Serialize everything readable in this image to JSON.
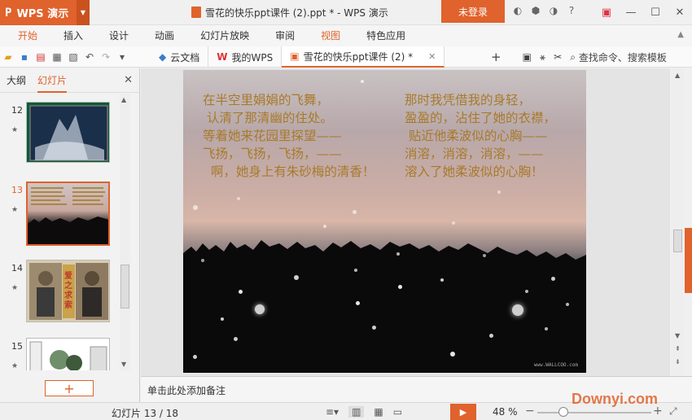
{
  "titlebar": {
    "app_name": "WPS 演示",
    "doc_title": "雪花的快乐ppt课件 (2).ppt * - WPS 演示",
    "login_label": "未登录"
  },
  "menu": {
    "items": [
      "开始",
      "插入",
      "设计",
      "动画",
      "幻灯片放映",
      "审阅",
      "视图",
      "特色应用"
    ]
  },
  "doc_tabs": [
    {
      "label": "云文档"
    },
    {
      "label": "我的WPS"
    },
    {
      "label": "雪花的快乐ppt课件 (2) *"
    }
  ],
  "toolbar": {
    "search_label": "查找命令、搜索模板"
  },
  "left_panel": {
    "tab_outline": "大纲",
    "tab_slides": "幻灯片",
    "thumbnails": [
      {
        "num": "12"
      },
      {
        "num": "13"
      },
      {
        "num": "14"
      },
      {
        "num": "15"
      }
    ],
    "thumb14_text": "爱之求索"
  },
  "slide": {
    "left_poem": "在半空里娟娟的飞舞，\n 认清了那清幽的住处。\n等着她来花园里探望——\n飞扬，飞扬，飞扬，——\n  啊，她身上有朱砂梅的清香！",
    "right_poem": "那时我凭借我的身轻，\n盈盈的，沾住了她的衣襟，\n 贴近他柔波似的心胸——\n消溶，消溶，消溶，——\n溶入了她柔波似的心胸！",
    "watermark": "www.WALLCOO.com"
  },
  "notes_placeholder": "单击此处添加备注",
  "status": {
    "slide_counter": "幻灯片 13 / 18",
    "zoom": "48 %"
  },
  "watermark_site": "Downyi.com",
  "colors": {
    "accent": "#e0622c",
    "poem_text": "#a87a2a"
  }
}
